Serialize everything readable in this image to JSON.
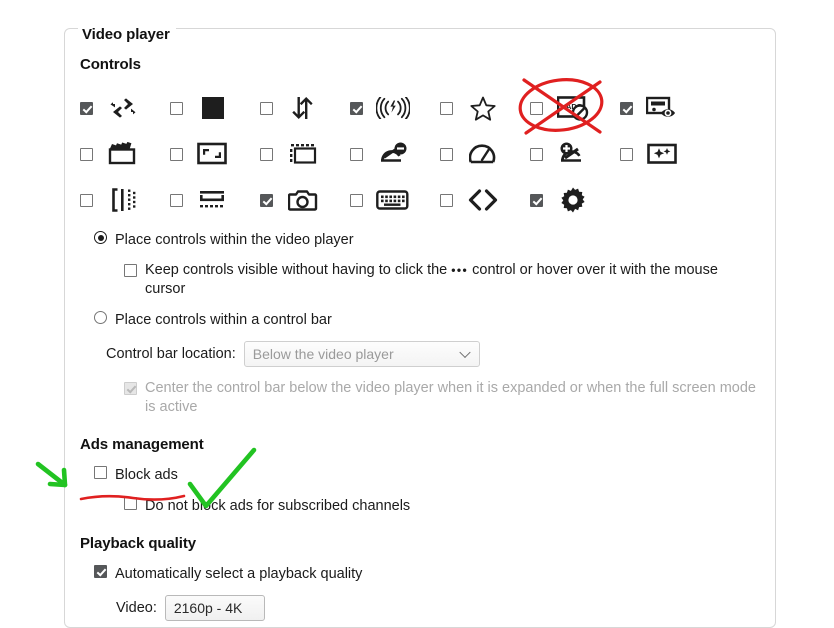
{
  "fieldset": {
    "legend": "Video player"
  },
  "controls": {
    "heading": "Controls",
    "items": [
      {
        "name": "loop-icon",
        "checked": true,
        "icon": "loop"
      },
      {
        "name": "theater-mode-icon",
        "checked": false,
        "icon": "filled-square"
      },
      {
        "name": "sort-order-icon",
        "checked": false,
        "icon": "arrows-up-down"
      },
      {
        "name": "volume-boost-icon",
        "checked": true,
        "icon": "volume-boost"
      },
      {
        "name": "favorite-star-icon",
        "checked": false,
        "icon": "star"
      },
      {
        "name": "block-ads-icon",
        "checked": false,
        "icon": "ads-block"
      },
      {
        "name": "preview-icon",
        "checked": true,
        "icon": "screen-eye"
      },
      {
        "name": "clapperboard-icon",
        "checked": false,
        "icon": "clapperboard"
      },
      {
        "name": "aspect-ratio-icon",
        "checked": false,
        "icon": "aspect-ratio"
      },
      {
        "name": "filmstrip-icon",
        "checked": false,
        "icon": "filmstrip"
      },
      {
        "name": "skip-segment-icon",
        "checked": false,
        "icon": "skip-minus"
      },
      {
        "name": "playback-speed-icon",
        "checked": false,
        "icon": "speedometer"
      },
      {
        "name": "add-segment-icon",
        "checked": false,
        "icon": "skip-plus"
      },
      {
        "name": "enhance-icon",
        "checked": false,
        "icon": "sparkle-screen"
      },
      {
        "name": "ab-repeat-icon",
        "checked": false,
        "icon": "ab-loop"
      },
      {
        "name": "subtitles-icon",
        "checked": false,
        "icon": "subtitle-lines"
      },
      {
        "name": "screenshot-icon",
        "checked": true,
        "icon": "camera"
      },
      {
        "name": "keyboard-shortcuts-icon",
        "checked": false,
        "icon": "keyboard"
      },
      {
        "name": "embed-code-icon",
        "checked": false,
        "icon": "angle-brackets"
      },
      {
        "name": "settings-gear-icon",
        "checked": true,
        "icon": "gear"
      }
    ]
  },
  "placement": {
    "option_in_player": "Place controls within the video player",
    "option_in_player_selected": true,
    "keep_visible_prefix": "Keep controls visible without having to click the",
    "keep_visible_ellipsis": "•••",
    "keep_visible_suffix": "control or hover over it with the mouse cursor",
    "keep_visible_checked": false,
    "option_in_bar": "Place controls within a control bar",
    "option_in_bar_selected": false,
    "control_bar_location_label": "Control bar location:",
    "control_bar_location_value": "Below the video player",
    "center_bar_label": "Center the control bar below the video player when it is expanded or when the full screen mode is active",
    "center_bar_checked": true,
    "center_bar_disabled": true
  },
  "ads": {
    "heading": "Ads management",
    "block_ads_label": "Block ads",
    "block_ads_checked": false,
    "subscribed_label": "Do not block ads for subscribed channels",
    "subscribed_checked": false
  },
  "playback": {
    "heading": "Playback quality",
    "auto_label": "Automatically select a playback quality",
    "auto_checked": true,
    "video_label": "Video:",
    "video_value": "2160p - 4K"
  },
  "annotations": {
    "red": "#e02020",
    "green": "#22c322",
    "red_cross_target": "block-ads-icon",
    "green_arrow_target": "block-ads-checkbox",
    "green_check_target": "block-ads-checkbox",
    "red_underline_target": "block-ads-label"
  }
}
